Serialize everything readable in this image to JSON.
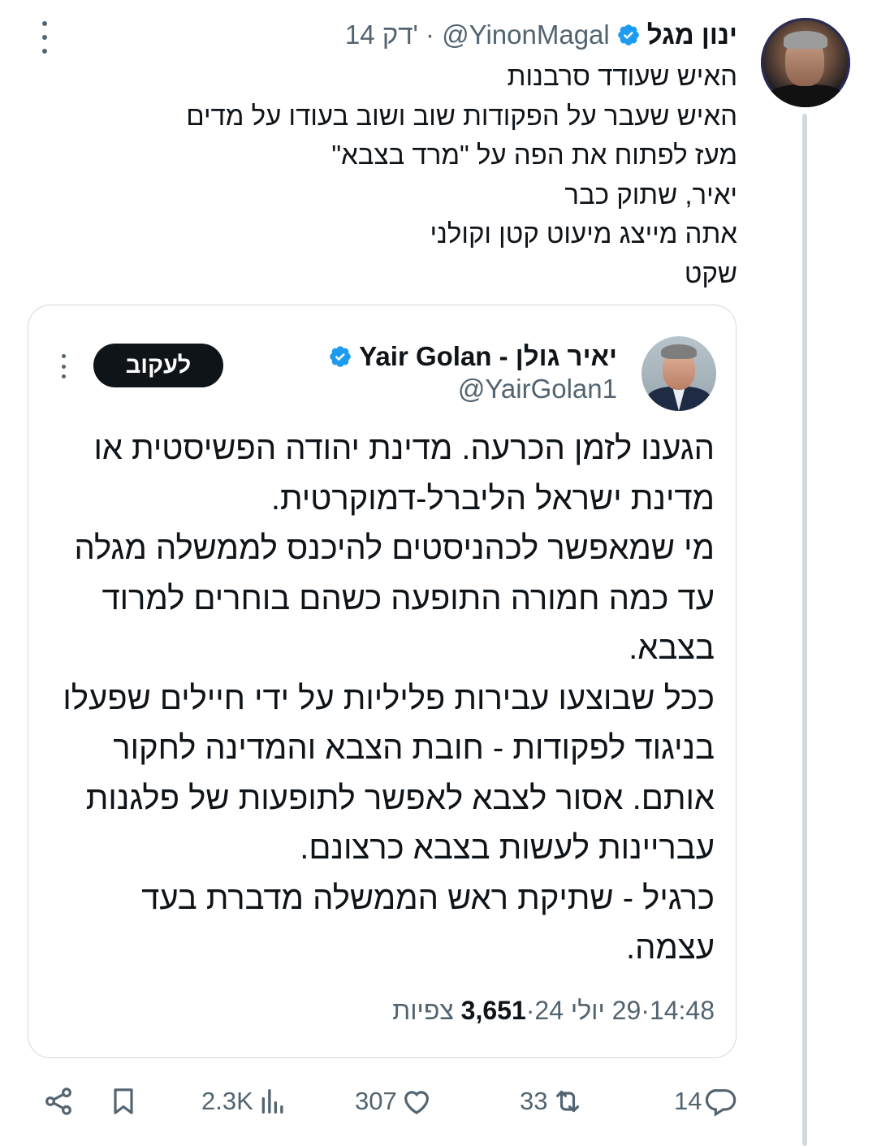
{
  "tweet": {
    "author_name": "ינון מגל",
    "handle": "@YinonMagal",
    "time": "14 דק'",
    "separator": "·",
    "text_lines": [
      "האיש שעודד סרבנות",
      "האיש שעבר על הפקודות שוב ושוב בעודו על מדים",
      "מעז לפתוח את הפה על \"מרד בצבא\"",
      "יאיר, שתוק כבר",
      "אתה מייצג מיעוט קטן וקולני",
      "שקט"
    ]
  },
  "quote": {
    "author_name": "יאיר גולן - Yair Golan",
    "handle": "@YairGolan1",
    "follow_label": "לעקוב",
    "text_lines": [
      "הגענו לזמן הכרעה. מדינת יהודה הפשיסטית או",
      "מדינת ישראל הליברל-דמוקרטית.",
      "מי שמאפשר לכהניסטים להיכנס לממשלה מגלה",
      "עד כמה חמורה התופעה כשהם בוחרים למרוד",
      "בצבא.",
      "ככל שבוצעו עבירות פליליות על ידי חיילים שפעלו",
      "בניגוד לפקודות - חובת הצבא והמדינה לחקור",
      "אותם. אסור לצבא לאפשר לתופעות של פלגנות",
      "עבריינות לעשות בצבא כרצונם.",
      "כרגיל - שתיקת ראש הממשלה מדברת בעד",
      "עצמה."
    ],
    "meta": {
      "time": "14:48",
      "date": "29 יולי 24",
      "separator": " · ",
      "views_count": "3,651",
      "views_label": "צפיות"
    }
  },
  "actions": {
    "replies": "14",
    "retweets": "33",
    "likes": "307",
    "views": "2.3K"
  },
  "colors": {
    "verified_blue": "#1d9bf0",
    "text_primary": "#0f1419",
    "text_secondary": "#536471",
    "border": "#cfd9de"
  },
  "icons": [
    "more-icon",
    "verified-icon",
    "reply-icon",
    "retweet-icon",
    "like-icon",
    "views-icon",
    "bookmark-icon",
    "share-icon"
  ]
}
